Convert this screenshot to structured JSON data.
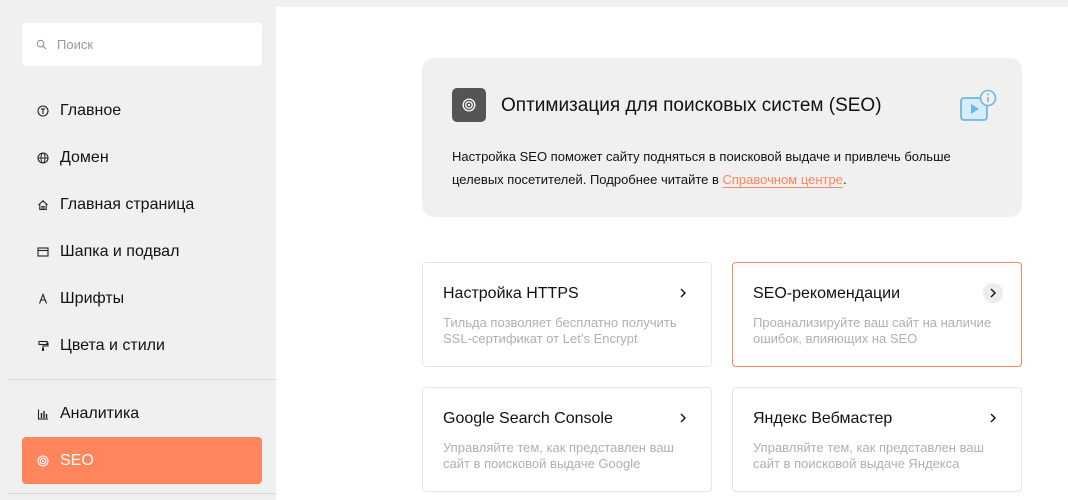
{
  "search": {
    "placeholder": "Поиск"
  },
  "sidebar": {
    "items": [
      {
        "label": "Главное",
        "icon": "info-circle-icon"
      },
      {
        "label": "Домен",
        "icon": "globe-icon"
      },
      {
        "label": "Главная страница",
        "icon": "home-icon"
      },
      {
        "label": "Шапка и подвал",
        "icon": "window-icon"
      },
      {
        "label": "Шрифты",
        "icon": "font-a-icon"
      },
      {
        "label": "Цвета и стили",
        "icon": "paint-roller-icon"
      },
      {
        "label": "Аналитика",
        "icon": "bar-chart-icon"
      },
      {
        "label": "SEO",
        "icon": "target-icon",
        "active": true
      }
    ]
  },
  "hero": {
    "title": "Оптимизация для поисковых систем (SEO)",
    "description_before": "Настройка SEO поможет сайту подняться в поисковой выдаче и привлечь больше целевых посетителей. Подробнее читайте в ",
    "link_text": "Справочном центре",
    "description_after": ".",
    "icon": "target-icon",
    "video_icon": "video-info-icon"
  },
  "cards": [
    {
      "title": "Настройка HTTPS",
      "description": "Тильда позволяет бесплатно получить SSL-сертификат от Let’s Encrypt"
    },
    {
      "title": "SEO-рекомендации",
      "description": "Проанализируйте ваш сайт на наличие ошибок, влияющих на SEO"
    },
    {
      "title": "Google Search Console",
      "description": "Управляйте тем, как представлен ваш сайт в поисковой выдаче Google"
    },
    {
      "title": "Яндекс Вебмастер",
      "description": "Управляйте тем, как представлен ваш сайт в поисковой выдаче Яндекса"
    }
  ],
  "colors": {
    "accent": "#ff855d",
    "sidebar_bg": "#f0f0f0",
    "panel_bg": "#f0f0f0"
  }
}
